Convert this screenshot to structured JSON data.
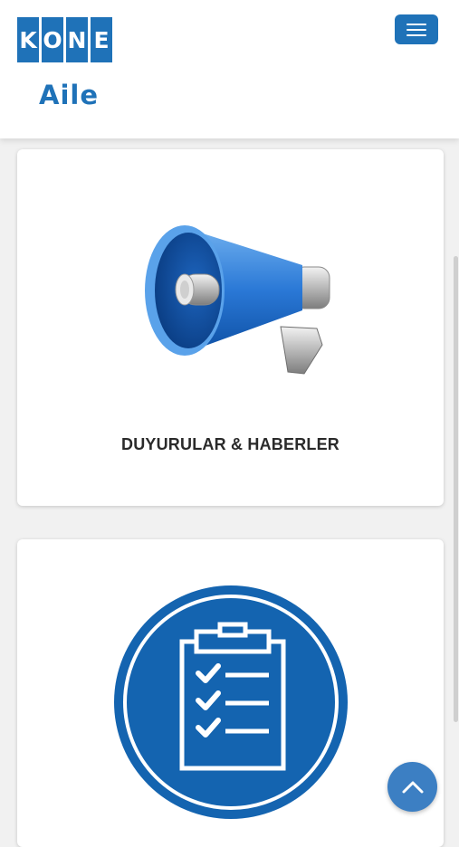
{
  "brand": {
    "logo_letters": [
      "K",
      "O",
      "N",
      "E"
    ],
    "subtitle": "Aile",
    "color": "#1f72b8"
  },
  "nav": {
    "menu_icon": "hamburger-icon"
  },
  "cards": [
    {
      "title": "DUYURULAR & HABERLER",
      "icon": "megaphone-icon"
    },
    {
      "title": "",
      "icon": "checklist-icon"
    }
  ],
  "scroll_top": {
    "icon": "chevron-up-icon"
  }
}
